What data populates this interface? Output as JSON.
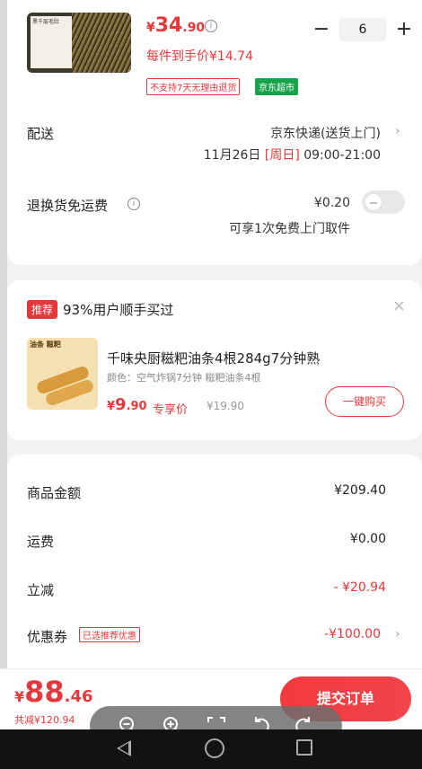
{
  "product": {
    "thumb_label": "黑千层毛肚",
    "price_yen": "¥",
    "price_int": "34",
    "price_dec": ".90",
    "quantity": "6",
    "minus": "−",
    "plus": "+",
    "unit_price": "每件到手价¥14.74",
    "tag_no_return": "不支持7天无理由退货",
    "tag_jd": "京东超市"
  },
  "delivery": {
    "label": "配送",
    "method": "京东快递(送货上门)",
    "date": "11月26日 ",
    "weekday": "[周日]",
    "time": " 09:00-21:00"
  },
  "return_shipping": {
    "label": "退换货免运费",
    "fee": "¥0.20",
    "note": "可享1次免费上门取件",
    "toggle_on": false
  },
  "recommend": {
    "tag": "推荐",
    "title": "93%用户顺手买过",
    "img_text": "油条 糍粑",
    "name": "千味央厨糍粑油条4根284g7分钟熟",
    "variant": "颜色：空气炸锅7分钟 糍粑油条4根",
    "price_yen": "¥",
    "price_int": "9",
    "price_dec": ".90",
    "exclusive": "专享价",
    "orig_price": "¥19.90",
    "buy_label": "一键购买"
  },
  "summary": {
    "goods_label": "商品金额",
    "goods_value": "¥209.40",
    "shipping_label": "运费",
    "shipping_value": "¥0.00",
    "discount_label": "立减",
    "discount_value": "- ¥20.94",
    "coupon_label": "优惠券",
    "coupon_tag": "已选推荐优惠",
    "coupon_value": "-¥100.00"
  },
  "footer": {
    "total_yen": "¥",
    "total_int": "88",
    "total_dec": ".46",
    "saved": "共减¥120.94",
    "submit": "提交订单"
  },
  "colors": {
    "accent": "#e4393c",
    "jd_green": "#17a34a"
  }
}
